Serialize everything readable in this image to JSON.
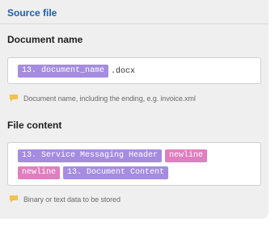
{
  "section": {
    "title": "Source file"
  },
  "document_name": {
    "label": "Document name",
    "tokens": [
      {
        "text": "13. document_name",
        "color": "#a58ce0"
      }
    ],
    "suffix": ".docx",
    "hint": "Document name, including the ending, e.g. invoice.xml",
    "hint_icon": "comment-icon"
  },
  "file_content": {
    "label": "File content",
    "rows": [
      [
        {
          "text": "13. Service Messaging Header",
          "color": "#a58ce0"
        },
        {
          "text": "newline",
          "color": "#e07fbf"
        }
      ],
      [
        {
          "text": "newline",
          "color": "#e07fbf"
        },
        {
          "text": "13. Document Content",
          "color": "#a58ce0"
        }
      ]
    ],
    "hint": "Binary or text data to be stored",
    "hint_icon": "comment-icon"
  },
  "colors": {
    "accent": "#1b5fae",
    "token_purple": "#a58ce0",
    "token_pink": "#e07fbf",
    "hint_icon": "#f4c24a"
  }
}
